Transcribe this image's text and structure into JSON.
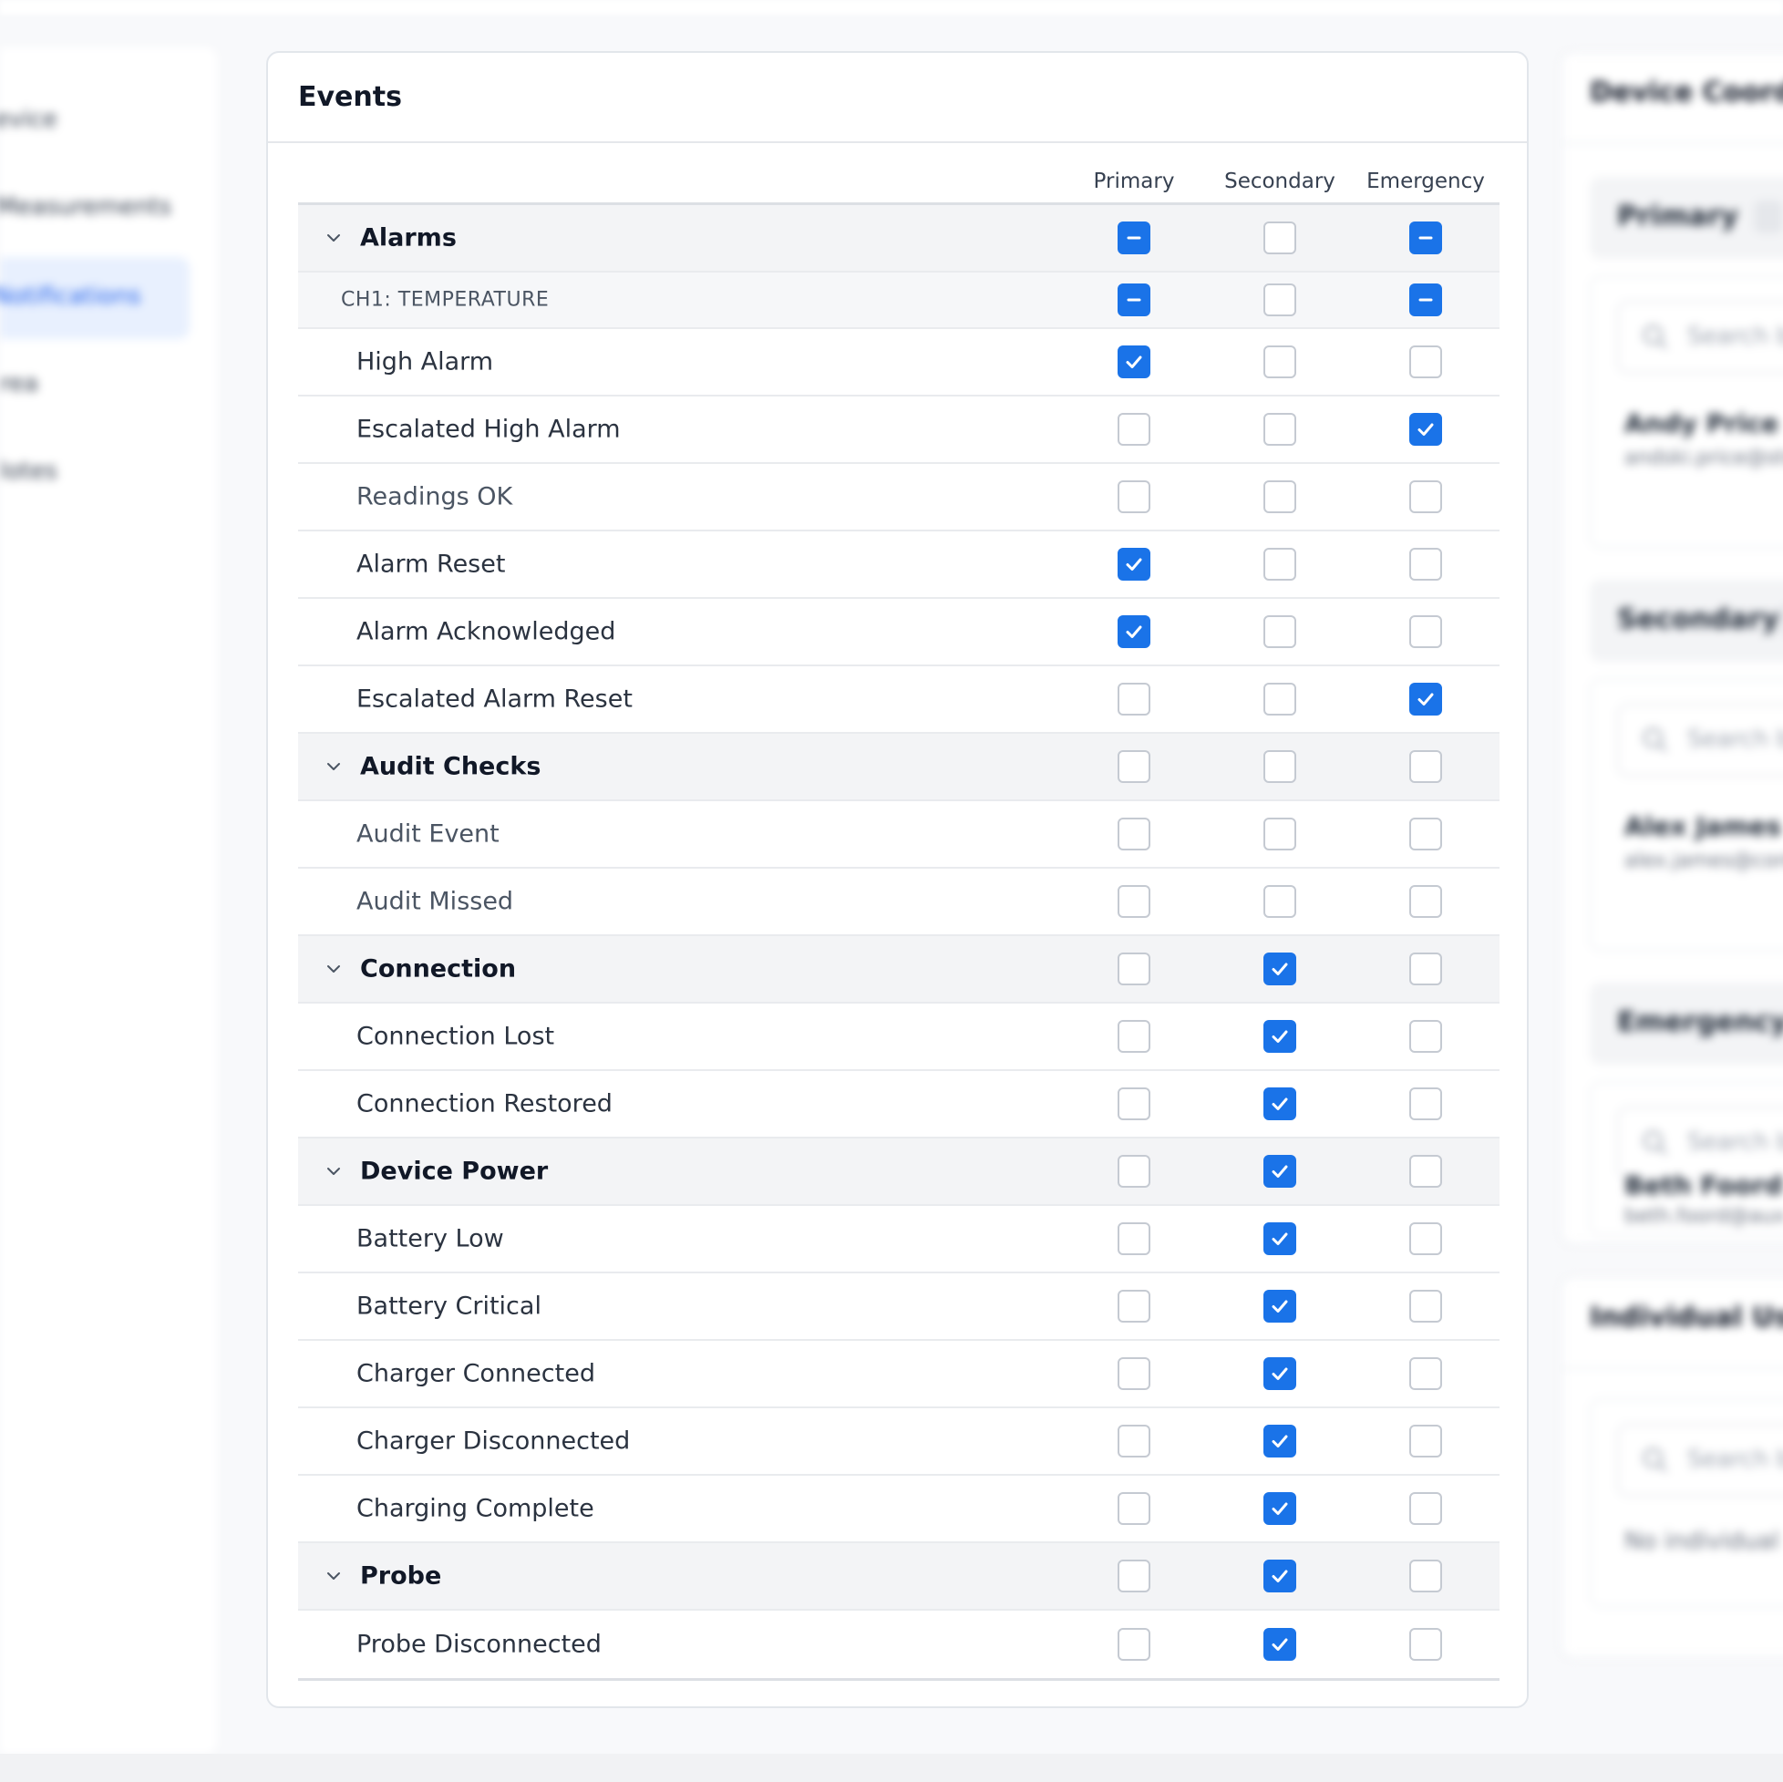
{
  "sidebar": {
    "items": [
      {
        "label": "evice",
        "active": false
      },
      {
        "label": "Measurements",
        "active": false
      },
      {
        "label": "Notifications",
        "active": true
      },
      {
        "label": "rea",
        "active": false
      },
      {
        "label": "lotes",
        "active": false
      }
    ]
  },
  "events": {
    "title": "Events",
    "columns": [
      "Primary",
      "Secondary",
      "Emergency"
    ],
    "rows": [
      {
        "type": "group",
        "label": "Alarms",
        "states": [
          "mixed",
          "off",
          "mixed"
        ]
      },
      {
        "type": "sub",
        "label": "CH1: TEMPERATURE",
        "states": [
          "mixed",
          "off",
          "mixed"
        ]
      },
      {
        "type": "item",
        "label": "High Alarm",
        "states": [
          "on",
          "off",
          "off"
        ]
      },
      {
        "type": "item",
        "label": "Escalated High Alarm",
        "states": [
          "off",
          "off",
          "on"
        ]
      },
      {
        "type": "item",
        "label": "Readings OK",
        "light": true,
        "states": [
          "off",
          "off",
          "off"
        ]
      },
      {
        "type": "item",
        "label": "Alarm Reset",
        "states": [
          "on",
          "off",
          "off"
        ]
      },
      {
        "type": "item",
        "label": "Alarm Acknowledged",
        "states": [
          "on",
          "off",
          "off"
        ]
      },
      {
        "type": "item",
        "label": "Escalated Alarm Reset",
        "states": [
          "off",
          "off",
          "on"
        ]
      },
      {
        "type": "group",
        "label": "Audit Checks",
        "states": [
          "off",
          "off",
          "off"
        ]
      },
      {
        "type": "item",
        "label": "Audit Event",
        "light": true,
        "states": [
          "off",
          "off",
          "off"
        ]
      },
      {
        "type": "item",
        "label": "Audit Missed",
        "light": true,
        "states": [
          "off",
          "off",
          "off"
        ]
      },
      {
        "type": "group",
        "label": "Connection",
        "states": [
          "off",
          "on",
          "off"
        ]
      },
      {
        "type": "item",
        "label": "Connection Lost",
        "states": [
          "off",
          "on",
          "off"
        ]
      },
      {
        "type": "item",
        "label": "Connection Restored",
        "states": [
          "off",
          "on",
          "off"
        ]
      },
      {
        "type": "group",
        "label": "Device Power",
        "states": [
          "off",
          "on",
          "off"
        ]
      },
      {
        "type": "item",
        "label": "Battery Low",
        "states": [
          "off",
          "on",
          "off"
        ]
      },
      {
        "type": "item",
        "label": "Battery Critical",
        "states": [
          "off",
          "on",
          "off"
        ]
      },
      {
        "type": "item",
        "label": "Charger Connected",
        "states": [
          "off",
          "on",
          "off"
        ]
      },
      {
        "type": "item",
        "label": "Charger Disconnected",
        "states": [
          "off",
          "on",
          "off"
        ]
      },
      {
        "type": "item",
        "label": "Charging Complete",
        "states": [
          "off",
          "on",
          "off"
        ]
      },
      {
        "type": "group",
        "label": "Probe",
        "states": [
          "off",
          "on",
          "off"
        ]
      },
      {
        "type": "item",
        "label": "Probe Disconnected",
        "states": [
          "off",
          "on",
          "off"
        ]
      }
    ]
  },
  "right_panel": {
    "coordinators_title": "Device Coordin",
    "groups": [
      {
        "label": "Primary",
        "search_placeholder": "Search b",
        "name": "Andy Price",
        "email": "andski.price@stw"
      },
      {
        "label": "Secondary",
        "search_placeholder": "Search b",
        "name": "Alex James",
        "email": "alex.james@contr"
      },
      {
        "label": "Emergency",
        "search_placeholder": "Search b",
        "name": "Beth Foord",
        "email": "beth.foord@aux"
      }
    ],
    "individual_title": "Individual User",
    "individual_search_placeholder": "Search b",
    "individual_empty": "No individual"
  },
  "colors": {
    "accent": "#1a73e8",
    "checkbox_border": "#c5cad2",
    "group_row_bg": "#f3f4f6"
  }
}
